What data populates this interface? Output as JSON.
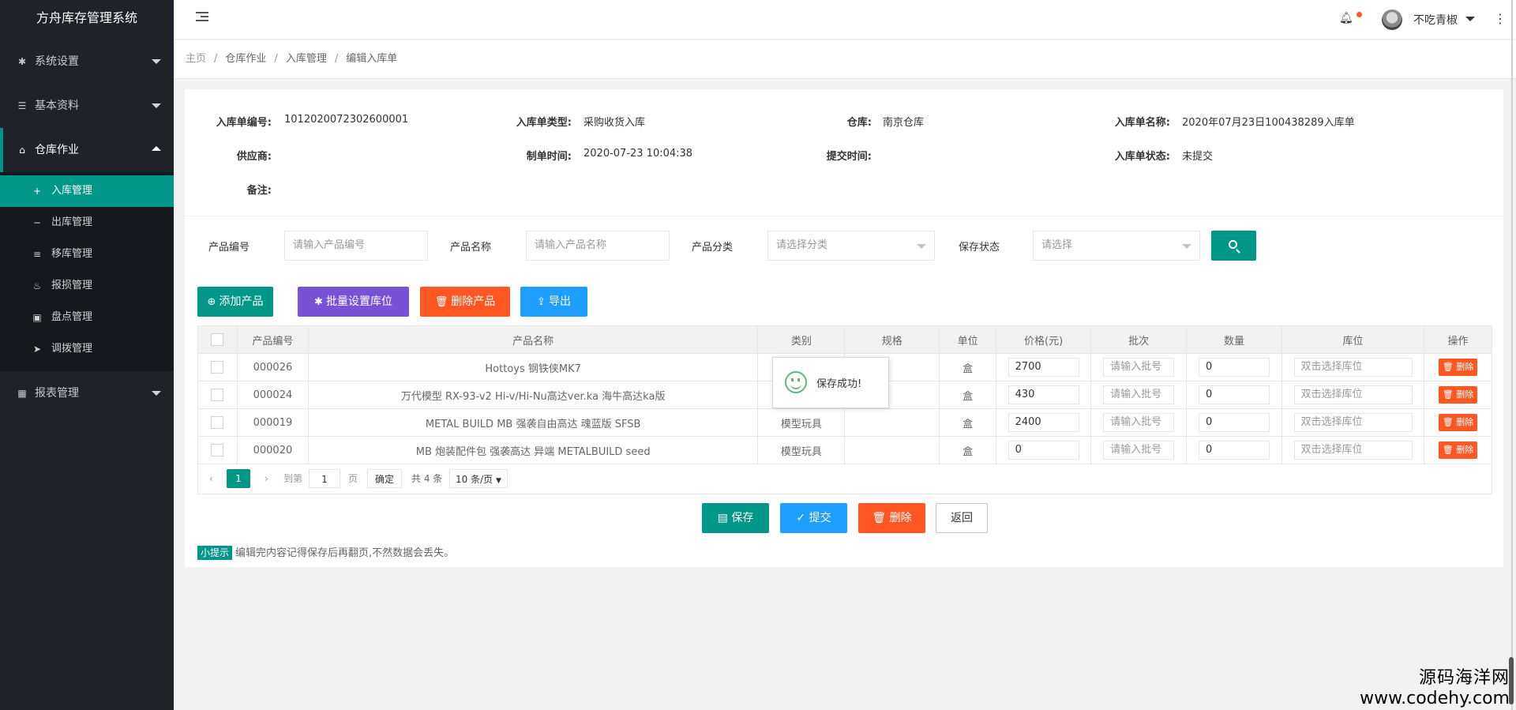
{
  "app": {
    "title": "方舟库存管理系统"
  },
  "sidebar": {
    "groups": [
      {
        "label": "系统设置",
        "icon": "gear-icon"
      },
      {
        "label": "基本资料",
        "icon": "list-icon"
      },
      {
        "label": "仓库作业",
        "icon": "home-icon"
      },
      {
        "label": "报表管理",
        "icon": "grid-icon"
      }
    ],
    "sub_items": [
      {
        "label": "入库管理",
        "icon": "plus-icon"
      },
      {
        "label": "出库管理",
        "icon": "minus-icon"
      },
      {
        "label": "移库管理",
        "icon": "sliders-icon"
      },
      {
        "label": "报损管理",
        "icon": "fire-icon"
      },
      {
        "label": "盘点管理",
        "icon": "clipboard-icon"
      },
      {
        "label": "调拨管理",
        "icon": "send-icon"
      }
    ]
  },
  "header": {
    "username": "不吃青椒"
  },
  "breadcrumb": [
    "主页",
    "仓库作业",
    "入库管理",
    "编辑入库单"
  ],
  "form": {
    "order_no_label": "入库单编号:",
    "order_no": "1012020072302600001",
    "type_label": "入库单类型:",
    "type": "采购收货入库",
    "warehouse_label": "仓库:",
    "warehouse": "南京仓库",
    "name_label": "入库单名称:",
    "name": "2020年07月23日100438289入库单",
    "supplier_label": "供应商:",
    "supplier": "",
    "created_label": "制单时间:",
    "created": "2020-07-23 10:04:38",
    "submitted_label": "提交时间:",
    "submitted": "",
    "status_label": "入库单状态:",
    "status": "未提交",
    "remark_label": "备注:",
    "remark": ""
  },
  "search": {
    "code_label": "产品编号",
    "code_placeholder": "请输入产品编号",
    "name_label": "产品名称",
    "name_placeholder": "请输入产品名称",
    "category_label": "产品分类",
    "category_placeholder": "请选择分类",
    "state_label": "保存状态",
    "state_placeholder": "请选择"
  },
  "toolbar": {
    "add": "添加产品",
    "batch": "批量设置库位",
    "delete": "删除产品",
    "export": "导出"
  },
  "table": {
    "headers": [
      "产品编号",
      "产品名称",
      "类别",
      "规格",
      "单位",
      "价格(元)",
      "批次",
      "数量",
      "库位",
      "操作"
    ],
    "batch_placeholder": "请输入批号",
    "location_placeholder": "双击选择库位",
    "delete_label": "删除",
    "rows": [
      {
        "code": "000026",
        "name": "Hottoys 钢铁侠MK7",
        "category": "",
        "spec": "",
        "unit": "盒",
        "price": "2700",
        "qty": "0"
      },
      {
        "code": "000024",
        "name": "万代模型 RX-93-v2 Hi-v/Hi-Nu高达ver.ka 海牛高达ka版",
        "category": "",
        "spec": "",
        "unit": "盒",
        "price": "430",
        "qty": "0"
      },
      {
        "code": "000019",
        "name": "METAL BUILD MB 强袭自由高达 魂蓝版 SFSB",
        "category": "模型玩具",
        "spec": "",
        "unit": "盒",
        "price": "2400",
        "qty": "0"
      },
      {
        "code": "000020",
        "name": "MB 炮装配件包 强袭高达 异端 METALBUILD seed",
        "category": "模型玩具",
        "spec": "",
        "unit": "盒",
        "price": "0",
        "qty": "0"
      }
    ]
  },
  "pager": {
    "current": "1",
    "goto_label": "到第",
    "goto_value": "1",
    "page_unit": "页",
    "confirm": "确定",
    "total": "共 4 条",
    "page_size": "10 条/页"
  },
  "toast": {
    "message": "保存成功!"
  },
  "actions": {
    "save": "保存",
    "submit": "提交",
    "delete": "删除",
    "back": "返回"
  },
  "tip": {
    "badge": "小提示",
    "text": "编辑完内容记得保存后再翻页,不然数据会丢失。"
  },
  "watermark": {
    "line1": "源码海洋网",
    "line2": "www.codehy.com"
  },
  "colors": {
    "primary": "#009688",
    "danger": "#ff5722",
    "purple": "#7752d6",
    "blue": "#1e9fff",
    "sidebar": "#20222a"
  }
}
